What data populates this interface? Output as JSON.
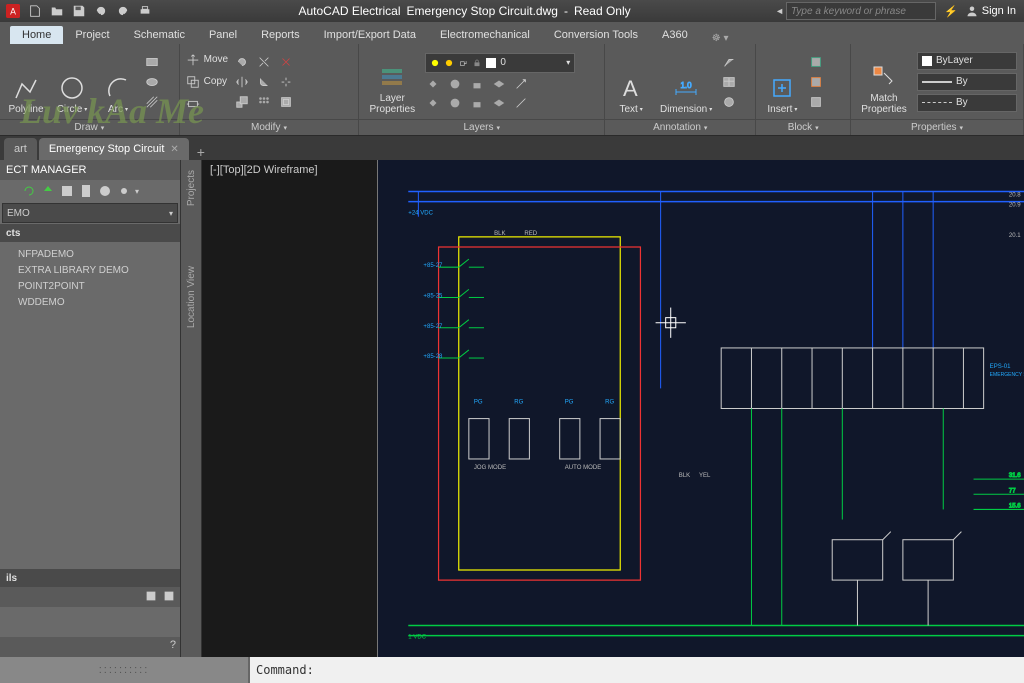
{
  "app": {
    "name": "AutoCAD Electrical",
    "file": "Emergency Stop Circuit.dwg",
    "state": "Read Only"
  },
  "titlebar": {
    "search_placeholder": "Type a keyword or phrase",
    "signin": "Sign In"
  },
  "ribbon_tabs": [
    {
      "label": "Home",
      "active": true
    },
    {
      "label": "Project",
      "active": false
    },
    {
      "label": "Schematic",
      "active": false
    },
    {
      "label": "Panel",
      "active": false
    },
    {
      "label": "Reports",
      "active": false
    },
    {
      "label": "Import/Export Data",
      "active": false
    },
    {
      "label": "Electromechanical",
      "active": false
    },
    {
      "label": "Conversion Tools",
      "active": false
    },
    {
      "label": "A360",
      "active": false
    }
  ],
  "ribbon": {
    "draw": {
      "title": "Draw",
      "polyline": "Polyline",
      "circle": "Circle",
      "arc": "Arc"
    },
    "modify": {
      "title": "Modify",
      "move": "Move",
      "copy": "Copy"
    },
    "layer": {
      "title": "Layers",
      "properties": "Layer\nProperties",
      "combo": "0"
    },
    "annotation": {
      "title": "Annotation",
      "text": "Text",
      "dimension": "Dimension"
    },
    "block": {
      "title": "Block",
      "insert": "Insert"
    },
    "properties": {
      "title": "Properties",
      "match": "Match\nProperties",
      "bylayer": "ByLayer",
      "byline1": "By",
      "byline2": "By"
    }
  },
  "file_tabs": {
    "tab0": "art",
    "tab1": "Emergency Stop Circuit",
    "new": "+"
  },
  "pm": {
    "header": "ECT MANAGER",
    "dropdown": "EMO",
    "section_projects": "cts",
    "items": [
      "NFPADEMO",
      "EXTRA LIBRARY DEMO",
      "POINT2POINT",
      "WDDEMO"
    ],
    "section_ils": "ils"
  },
  "side": {
    "projects": "Projects",
    "location": "Location View"
  },
  "viewport": {
    "label": "[-][Top][2D Wireframe]"
  },
  "cmd": {
    "prompt": "Command:"
  },
  "schematic_labels": {
    "vdc24": "+24 VDC",
    "vdc1": "1 VDC",
    "jog": "JOG MODE",
    "auto": "AUTO MODE",
    "relay": "EMERGENCY STOP RELAY",
    "blk": "BLK",
    "red": "RED",
    "yel": "YEL"
  }
}
